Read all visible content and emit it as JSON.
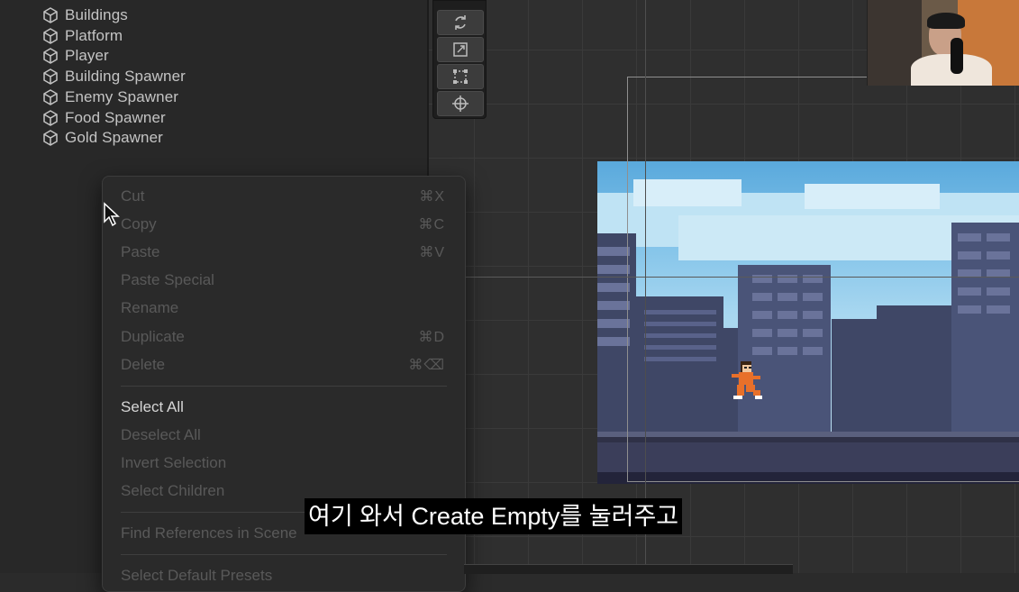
{
  "hierarchy": {
    "items": [
      {
        "label": "Buildings",
        "icon": "cube-icon"
      },
      {
        "label": "Platform",
        "icon": "cube-icon"
      },
      {
        "label": "Player",
        "icon": "cube-icon"
      },
      {
        "label": "Building Spawner",
        "icon": "cube-icon"
      },
      {
        "label": "Enemy Spawner",
        "icon": "cube-icon"
      },
      {
        "label": "Food Spawner",
        "icon": "cube-icon"
      },
      {
        "label": "Gold Spawner",
        "icon": "cube-icon"
      }
    ]
  },
  "toolbox": {
    "tools": [
      "rotate-tool-icon",
      "scale-tool-icon",
      "rect-tool-icon",
      "transform-tool-icon"
    ]
  },
  "context_menu": {
    "items": [
      {
        "label": "Cut",
        "shortcut": "⌘X",
        "enabled": false
      },
      {
        "label": "Copy",
        "shortcut": "⌘C",
        "enabled": false
      },
      {
        "label": "Paste",
        "shortcut": "⌘V",
        "enabled": false
      },
      {
        "label": "Paste Special",
        "shortcut": "",
        "enabled": false
      },
      {
        "label": "Rename",
        "shortcut": "",
        "enabled": false
      },
      {
        "label": "Duplicate",
        "shortcut": "⌘D",
        "enabled": false
      },
      {
        "label": "Delete",
        "shortcut": "⌘⌫",
        "enabled": false
      },
      {
        "label": "Select All",
        "shortcut": "",
        "enabled": true
      },
      {
        "label": "Deselect All",
        "shortcut": "",
        "enabled": false
      },
      {
        "label": "Invert Selection",
        "shortcut": "",
        "enabled": false
      },
      {
        "label": "Select Children",
        "shortcut": "",
        "enabled": false
      },
      {
        "label": "Find References in Scene",
        "shortcut": "",
        "enabled": false
      },
      {
        "label": "Select Default Presets",
        "shortcut": "",
        "enabled": false
      }
    ]
  },
  "subtitle": "여기 와서 Create Empty를 눌러주고",
  "colors": {
    "panel_bg": "#282828",
    "menu_bg": "#2a2a2a",
    "menu_text_enabled": "#d6d6d6",
    "menu_text_disabled": "#595959",
    "sky": "#7cc0e8",
    "buildings": "#4a5478"
  }
}
